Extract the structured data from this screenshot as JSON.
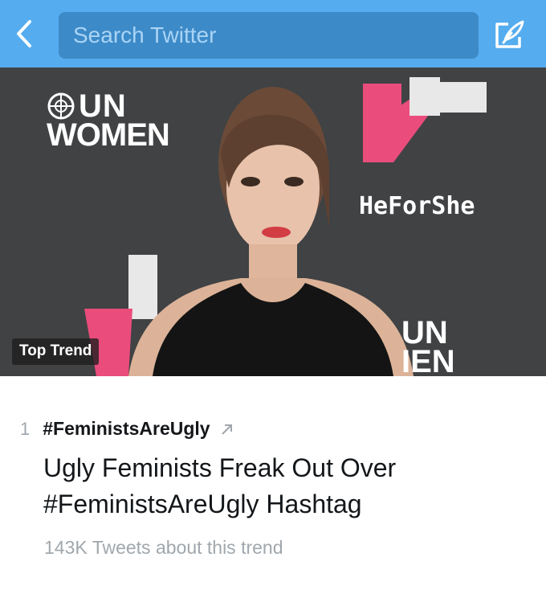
{
  "header": {
    "back_icon": "chevron-left-icon",
    "search_placeholder": "Search Twitter",
    "compose_icon": "compose-icon",
    "bg_color": "#55acee"
  },
  "hero": {
    "logo_un": "UN",
    "logo_women": "WOMEN",
    "campaign": "HeForShe",
    "logo_un_2": "UN",
    "logo_women_2": "IEN",
    "badge": "Top Trend",
    "accent_pink": "#ea4c7c"
  },
  "trend": {
    "rank": "1",
    "hashtag": "#FeministsAreUgly",
    "headline": "Ugly Feminists Freak Out Over #FeministsAreUgly Hashtag",
    "tweets": "143K Tweets about this trend"
  }
}
